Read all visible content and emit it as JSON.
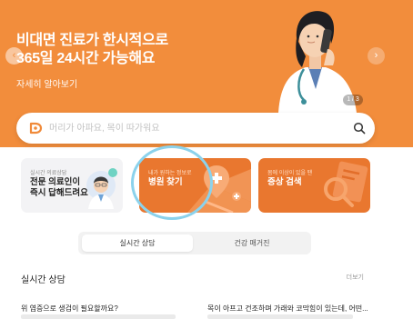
{
  "hero": {
    "title_line1": "비대면 진료가 한시적으로",
    "title_line2": "365일 24시간 가능해요",
    "link": "자세히 알아보기",
    "pager": "1 / 3",
    "prev_icon": "chevron-left-icon",
    "next_icon": "chevron-right-icon",
    "colors": {
      "background": "#f28d3c"
    }
  },
  "search": {
    "placeholder": "머리가 아파요, 목이 따가워요",
    "icon": "search-icon",
    "logo_icon": "brand-logo-icon"
  },
  "cards": [
    {
      "small": "실시간 의료상담",
      "line1": "전문 의료인이",
      "line2": "즉시 답해드려요"
    },
    {
      "small": "내가 원하는 정보로",
      "title": "병원 찾기"
    },
    {
      "small": "몸에 이상이 있을 땐",
      "title": "증상 검색"
    }
  ],
  "tabs": [
    {
      "label": "실시간 상담",
      "selected": true
    },
    {
      "label": "건강 매거진",
      "selected": false
    }
  ],
  "section": {
    "title": "실시간 상담",
    "more": "더보기"
  },
  "questions": [
    {
      "title": "위 염증으로 생검이 필요할까요?"
    },
    {
      "title": "목이 아프고 건조하며 가래와 코막힘이 있는데, 어떤..."
    }
  ],
  "colors": {
    "accent": "#e9772f",
    "focus_ring": "#8bd2ec"
  }
}
